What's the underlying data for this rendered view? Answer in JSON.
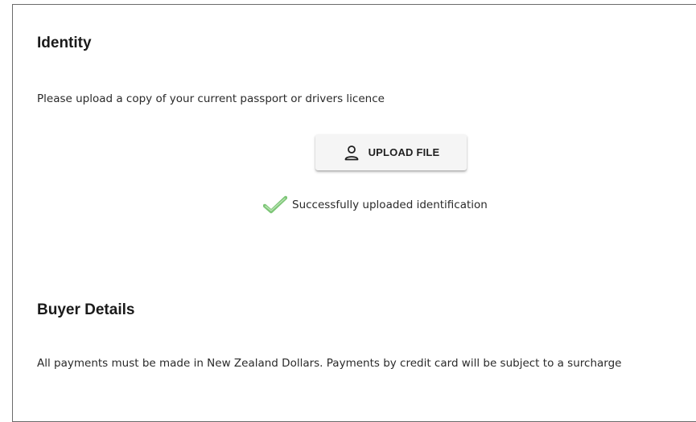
{
  "identity": {
    "heading": "Identity",
    "instruction": "Please upload a copy of your current passport or drivers licence",
    "upload_button": {
      "label": "UPLOAD FILE",
      "icon": "person-icon"
    },
    "status": {
      "icon": "checkmark-icon",
      "icon_color": "#7cc576",
      "message": "Successfully uploaded identification"
    }
  },
  "buyer": {
    "heading": "Buyer Details",
    "note": "All payments must be made in New Zealand Dollars. Payments by credit card will be subject to a surcharge"
  }
}
